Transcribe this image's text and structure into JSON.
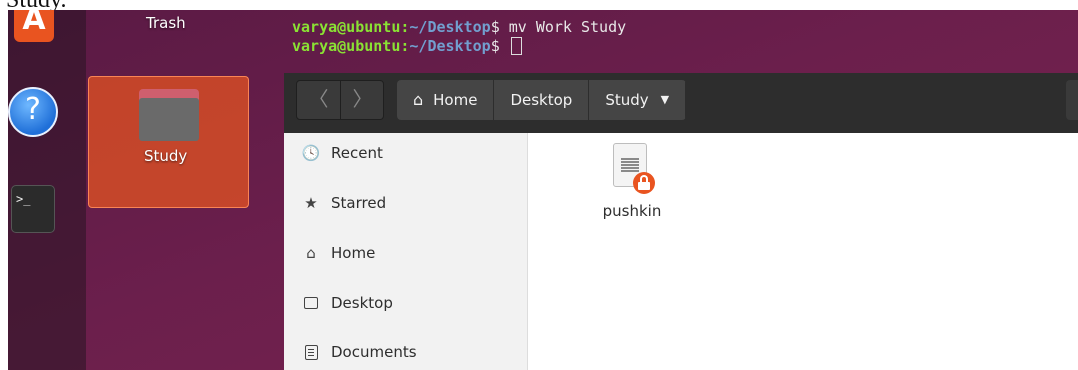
{
  "document": {
    "caption_fragment": "Study."
  },
  "dock": {
    "items": [
      {
        "name": "ubuntu-software",
        "icon": "app-store-icon",
        "glyph": "A",
        "color": "#e95420"
      },
      {
        "name": "help",
        "icon": "help-icon",
        "glyph": "?",
        "color": "#1f6fd8"
      },
      {
        "name": "terminal",
        "icon": "terminal-icon",
        "glyph": ">_"
      }
    ]
  },
  "desktop": {
    "icons": [
      {
        "label": "Trash"
      },
      {
        "label": "Study",
        "selected": true
      }
    ]
  },
  "terminal": {
    "lines": [
      {
        "user": "varya@ubuntu",
        "sep": ":",
        "path": "~/Desktop",
        "prompt": "$ ",
        "command": "mv Work Study"
      },
      {
        "user": "varya@ubuntu",
        "sep": ":",
        "path": "~/Desktop",
        "prompt": "$ ",
        "command": ""
      }
    ],
    "colors": {
      "user": "#8ae234",
      "path": "#729fcf"
    }
  },
  "file_manager": {
    "nav": {
      "back_glyph": "〈",
      "forward_glyph": "〉"
    },
    "breadcrumb": [
      {
        "label": "Home",
        "icon": "home-icon",
        "glyph": "⌂"
      },
      {
        "label": "Desktop"
      },
      {
        "label": "Study",
        "dropdown_glyph": "▼"
      }
    ],
    "sidebar": [
      {
        "label": "Recent",
        "icon": "clock-icon",
        "glyph": "🕓"
      },
      {
        "label": "Starred",
        "icon": "star-icon",
        "glyph": "★"
      },
      {
        "label": "Home",
        "icon": "home-icon",
        "glyph": "⌂"
      },
      {
        "label": "Desktop",
        "icon": "desktop-icon"
      },
      {
        "label": "Documents",
        "icon": "documents-icon"
      }
    ],
    "files": [
      {
        "name": "pushkin",
        "icon": "text-file-icon",
        "badge": "lock-icon"
      }
    ],
    "colors": {
      "header": "#2d2d2d",
      "sidebar": "#f2f2f2",
      "accent": "#e95420"
    }
  }
}
